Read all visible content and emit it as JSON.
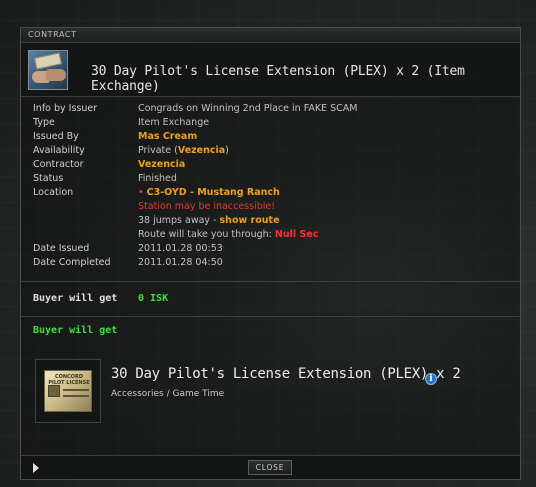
{
  "window": {
    "title": "CONTRACT"
  },
  "header": {
    "title": "30 Day Pilot's License Extension (PLEX) x 2 (Item Exchange)"
  },
  "details": {
    "info_by_issuer": {
      "label": "Info by Issuer",
      "value": "Congrads on Winning 2nd Place in FAKE SCAM"
    },
    "type": {
      "label": "Type",
      "value": "Item Exchange"
    },
    "issued_by": {
      "label": "Issued By",
      "value": "Mas Cream"
    },
    "availability": {
      "label": "Availability",
      "prefix": "Private (",
      "link": "Vezencia",
      "suffix": ")"
    },
    "contractor": {
      "label": "Contractor",
      "value": "Vezencia"
    },
    "status": {
      "label": "Status",
      "value": "Finished"
    },
    "location": {
      "label": "Location",
      "security": "•",
      "name": "C3-OYD - Mustang Ranch",
      "warning": "Station may be inaccessible!",
      "jumps": "38 jumps away - ",
      "show_route": "show route",
      "route_prefix": "Route will take you through: ",
      "route_sec": "Null Sec"
    },
    "date_issued": {
      "label": "Date Issued",
      "value": "2011.01.28 00:53"
    },
    "date_completed": {
      "label": "Date Completed",
      "value": "2011.01.28 04:50"
    }
  },
  "buyer_gets_isk": {
    "label": "Buyer will get",
    "value": "0 ISK"
  },
  "buyer_gets_items": {
    "label": "Buyer will get",
    "item": {
      "name": "30 Day Pilot's License Extension (PLEX) x 2",
      "category": "Accessories / Game Time",
      "card_text": "CONCORD PILOT LICENSE"
    }
  },
  "footer": {
    "close_label": "CLOSE"
  },
  "colors": {
    "highlight_orange": "#f0a020",
    "warning_red": "#ff3030",
    "isk_green": "#3ce23c",
    "info_blue": "#2a6fc9"
  }
}
